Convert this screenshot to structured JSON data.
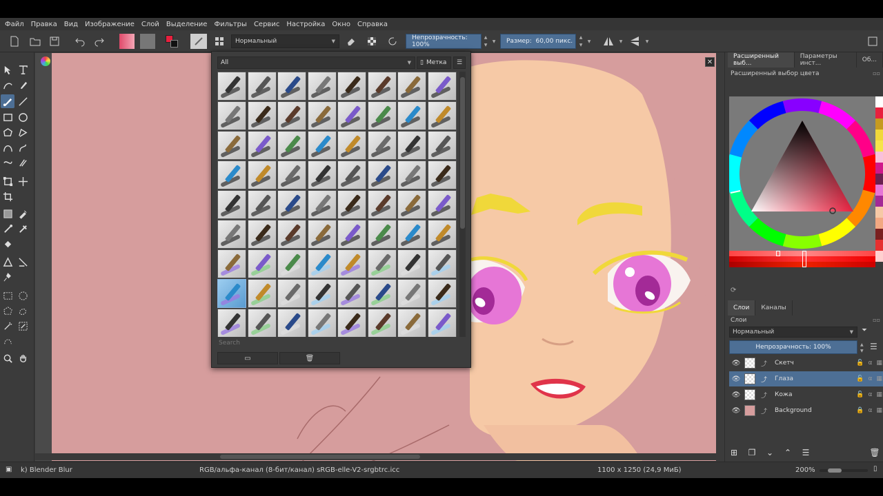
{
  "menu": [
    "Файл",
    "Правка",
    "Вид",
    "Изображение",
    "Слой",
    "Выделение",
    "Фильтры",
    "Сервис",
    "Настройка",
    "Окно",
    "Справка"
  ],
  "toolbar": {
    "blend_mode": "Нормальный",
    "opacity_label": "Непрозрачность: 100%",
    "size_label": "Размер:",
    "size_value": "60,00 пикс."
  },
  "brush_popup": {
    "filter": "All",
    "tag_label": "Метка",
    "search_placeholder": "Search"
  },
  "docker": {
    "tabs": [
      "Расширенный выб...",
      "Параметры инст...",
      "Об..."
    ],
    "color_title": "Расширенный выбор цвета",
    "layers_tabs": [
      "Слои",
      "Каналы"
    ],
    "layers_title": "Слои",
    "layers_blend": "Нормальный",
    "layers_opacity": "Непрозрачность:  100%",
    "layers": [
      {
        "name": "Скетч",
        "selected": false,
        "thumb": "checker"
      },
      {
        "name": "Глаза",
        "selected": true,
        "thumb": "checker"
      },
      {
        "name": "Кожа",
        "selected": false,
        "thumb": "checker"
      },
      {
        "name": "Background",
        "selected": false,
        "thumb": "#d69d9d"
      }
    ]
  },
  "statusbar": {
    "brush": "k) Blender Blur",
    "colorspace": "RGB/альфа-канал (8-бит/канал)  sRGB-elle-V2-srgbtrc.icc",
    "dimensions": "1100 x 1250 (24,9 МиБ)",
    "zoom": "200%"
  },
  "colors": {
    "accent": "#4d6f95",
    "canvas_bg": "#d69d9d",
    "skin": "#f6c9a6",
    "eye_pink": "#e676d6",
    "brow_yellow": "#f0d83a"
  }
}
